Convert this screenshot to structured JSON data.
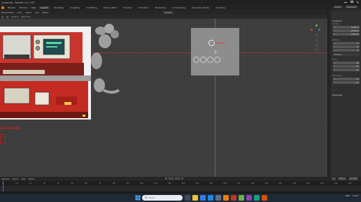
{
  "window": {
    "title": "[Unsaved] - Blender 4.5.1 LTS"
  },
  "menubar": {
    "items": [
      "Blender",
      "Window",
      "Help"
    ],
    "tabs": [
      "Layout",
      "Modeling",
      "Sculpting",
      "UV Editing",
      "Texture Paint",
      "Shading",
      "Animation",
      "Rendering",
      "Compositing",
      "Geometry Nodes",
      "Scripting"
    ],
    "active_tab": "Layout",
    "right": {
      "scene": "Scene",
      "view_layer": "ViewLayer"
    }
  },
  "viewport_header": {
    "items": [
      "Object Mode",
      "View",
      "Select",
      "Add",
      "Object"
    ],
    "orientation": "Global"
  },
  "viewport_tools": {
    "items": [
      "Options",
      "Select Box"
    ]
  },
  "overlay_text": "RECORDING",
  "properties": {
    "section": "Transform",
    "location_label": "Location",
    "location": [
      {
        "axis": "X",
        "value": "-0.3214 m"
      },
      {
        "axis": "Y",
        "value": "0.1044 m"
      },
      {
        "axis": "Z",
        "value": "0.6574 m"
      }
    ],
    "rotation_label": "Rotation",
    "rotation": [
      {
        "axis": "X",
        "value": "0°"
      },
      {
        "axis": "Y",
        "value": "0°"
      },
      {
        "axis": "Z",
        "value": "0°"
      }
    ],
    "rotation_mode": "XYZ Euler",
    "scale_label": "Scale",
    "scale": [
      {
        "axis": "X",
        "value": "0.5"
      },
      {
        "axis": "Y",
        "value": "0.5"
      },
      {
        "axis": "Z",
        "value": "0.5"
      }
    ],
    "dimensions_label": "Dimensions",
    "dimensions": [
      {
        "axis": "X",
        "value": "1 m"
      },
      {
        "axis": "Y",
        "value": "1 m"
      }
    ],
    "properties_label": "Properties"
  },
  "timeline": {
    "header": [
      "Playback",
      "Keying",
      "View",
      "Marker"
    ],
    "start_label": "Start",
    "start": "1",
    "end_label": "End",
    "end": "250",
    "current": "1",
    "ticks": [
      "0",
      "10",
      "20",
      "30",
      "40",
      "50",
      "60",
      "70",
      "80",
      "90",
      "100",
      "110",
      "120",
      "130",
      "140",
      "150",
      "160",
      "170",
      "180",
      "190",
      "200",
      "210",
      "220",
      "230",
      "240",
      "250"
    ]
  },
  "taskbar": {
    "search_placeholder": "Поиск",
    "language": "ENG",
    "time": "14:32"
  },
  "colors": {
    "accent": "#4772b3",
    "x_axis": "#d83c3c",
    "y_axis": "#6ab04c"
  }
}
